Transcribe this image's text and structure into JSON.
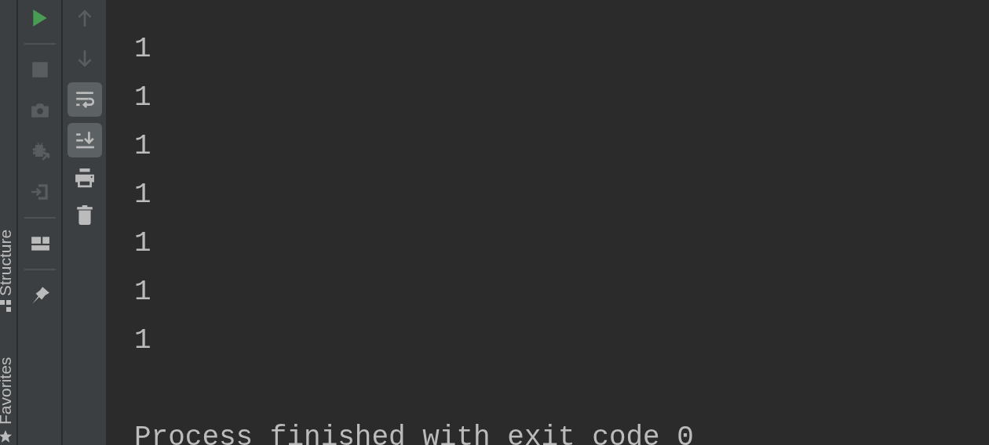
{
  "side_tabs": [
    {
      "label": "Structure"
    },
    {
      "label": "Favorites"
    }
  ],
  "run_toolbar": [
    {
      "kind": "button",
      "disabled": false
    },
    {
      "kind": "separator"
    },
    {
      "kind": "button",
      "disabled": true
    },
    {
      "kind": "button",
      "disabled": true
    },
    {
      "kind": "button",
      "disabled": true
    },
    {
      "kind": "button",
      "disabled": true
    },
    {
      "kind": "separator"
    },
    {
      "kind": "button",
      "disabled": false
    },
    {
      "kind": "separator"
    },
    {
      "kind": "button",
      "disabled": false
    }
  ],
  "console_toolbar": [
    {
      "disabled": true,
      "selected": false
    },
    {
      "disabled": true,
      "selected": false
    },
    {
      "disabled": false,
      "selected": true
    },
    {
      "disabled": false,
      "selected": true
    },
    {
      "disabled": false,
      "selected": false
    },
    {
      "disabled": false,
      "selected": false
    }
  ],
  "console": {
    "lines": [
      "1",
      "1",
      "1",
      "1",
      "1",
      "1",
      "1"
    ],
    "exit_message": "Process finished with exit code 0"
  }
}
